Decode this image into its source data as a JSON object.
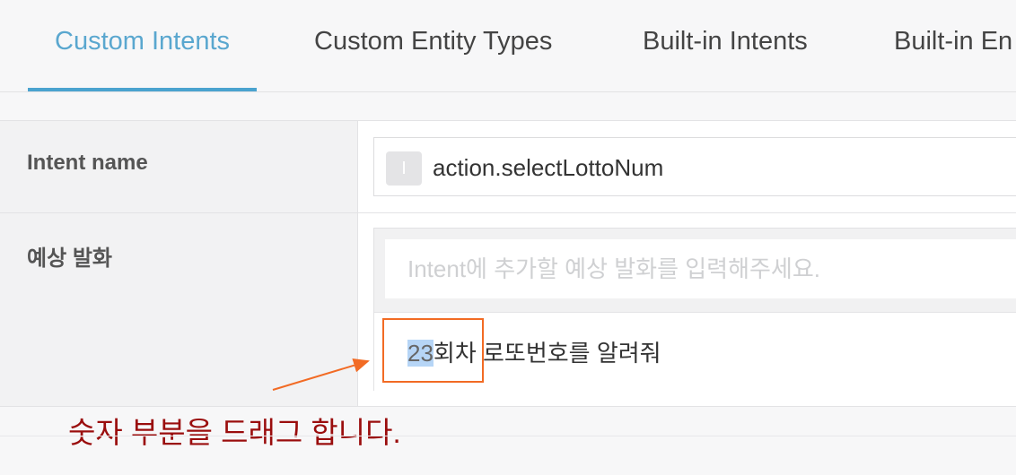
{
  "tabs": [
    {
      "label": "Custom Intents",
      "active": true
    },
    {
      "label": "Custom Entity Types",
      "active": false
    },
    {
      "label": "Built-in Intents",
      "active": false
    },
    {
      "label": "Built-in En",
      "active": false
    }
  ],
  "form": {
    "intent_name": {
      "label": "Intent name",
      "badge": "I",
      "value": "action.selectLottoNum"
    },
    "utterances": {
      "label": "예상 발화",
      "placeholder": "Intent에 추가할 예상 발화를 입력해주세요.",
      "items": [
        {
          "selected": "23",
          "rest_before_space": "회차",
          "rest": " 로또번호를 알려줘"
        }
      ]
    }
  },
  "annotation": {
    "text": "숫자 부분을 드래그 합니다.",
    "color": "#9a0d0d",
    "box_color": "#f26b24"
  },
  "colors": {
    "accent": "#4aa3cf",
    "selection": "#b6d5f6"
  }
}
